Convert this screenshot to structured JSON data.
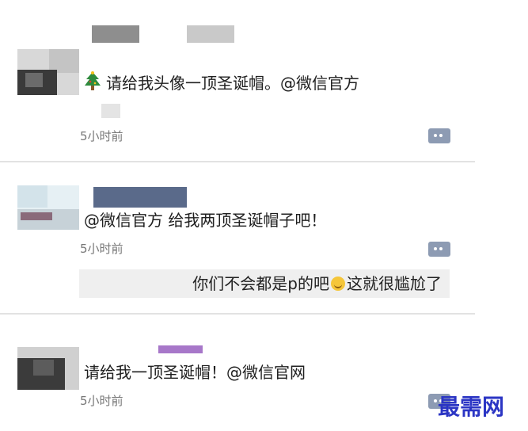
{
  "posts": [
    {
      "text": "请给我头像一顶圣诞帽。@微信官方",
      "time": "5小时前",
      "icon": "christmas-tree-icon"
    },
    {
      "text": "@微信官方 给我两顶圣诞帽子吧！",
      "time": "5小时前",
      "reply": {
        "before": "你们不会都是p的吧",
        "emoji": "smile-emoji-icon",
        "after": "这就很尴尬了"
      }
    },
    {
      "text": "请给我一顶圣诞帽！@微信官网",
      "time": "5小时前"
    }
  ],
  "watermark": "最需网",
  "colors": {
    "comment_button": "#8d9bb3",
    "watermark": "#2b35c4",
    "reply_bg": "#efefef",
    "time_text": "#777777"
  }
}
